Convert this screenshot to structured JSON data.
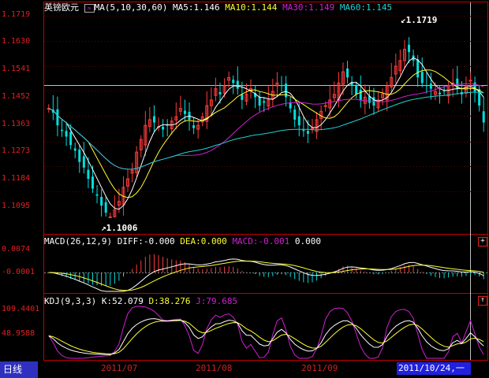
{
  "symbol": "英镑欧元",
  "colors": {
    "frame": "#c00000",
    "up": "#ff3c3c",
    "down": "#00e0e0",
    "ma5": "#ffffff",
    "ma10": "#ffff30",
    "ma30": "#d020d0",
    "ma60": "#20d0d0",
    "macd_pos": "#ff3c3c",
    "macd_neg": "#00e0e0",
    "diff": "#ffffff",
    "dea": "#ffff30",
    "k": "#ffffff",
    "d": "#ffff30",
    "j": "#d020d0",
    "bottom_tab_bg": "#3030c0",
    "date_bg": "#2020e0"
  },
  "price_panel": {
    "legend": {
      "icon": "ma-legend-icon",
      "ma_label": "MA(5,10,30,60)",
      "ma5": "MA5:1.146",
      "ma10": "MA10:1.144",
      "ma30": "MA30:1.149",
      "ma60": "MA60:1.145"
    },
    "y_labels": [
      "1.1719",
      "1.1630",
      "1.1541",
      "1.1452",
      "1.1363",
      "1.1273",
      "1.1184",
      "1.1095"
    ],
    "high_label": "1.1719",
    "low_label": "1.1006"
  },
  "macd_panel": {
    "title": "MACD(26,12,9)",
    "diff": "DIFF:-0.000",
    "dea": "DEA:0.000",
    "macd": "MACD:-0.001",
    "extra": "0.000",
    "y_labels": [
      "0.0074",
      "-0.0001"
    ],
    "expand_icon": "plus-icon"
  },
  "kdj_panel": {
    "title": "KDJ(9,3,3)",
    "k": "K:52.079",
    "d": "D:38.276",
    "j": "J:79.685",
    "y_labels": [
      "109.4401",
      "48.9588"
    ],
    "expand_icon": "up-arrow-icon"
  },
  "x_axis": {
    "ticks": [
      "2011/07",
      "2011/08",
      "2011/09"
    ],
    "current_date": "2011/10/24,一"
  },
  "bottom_tab": "日线",
  "chart_data": [
    {
      "type": "candlestick",
      "title": "英镑欧元",
      "ylim": [
        1.1006,
        1.1719
      ],
      "x_ticks": [
        "2011/07",
        "2011/08",
        "2011/09"
      ],
      "series": [
        {
          "name": "MA5",
          "last": 1.146
        },
        {
          "name": "MA10",
          "last": 1.144
        },
        {
          "name": "MA30",
          "last": 1.149
        },
        {
          "name": "MA60",
          "last": 1.145
        }
      ],
      "annotations": {
        "high": 1.1719,
        "low": 1.1006
      },
      "close": [
        1.139,
        1.1375,
        1.133,
        1.131,
        1.129,
        1.126,
        1.124,
        1.12,
        1.118,
        1.114,
        1.1105,
        1.108,
        1.1045,
        1.102,
        1.1005,
        1.103,
        1.106,
        1.111,
        1.114,
        1.117,
        1.1235,
        1.128,
        1.133,
        1.135,
        1.134,
        1.1325,
        1.1315,
        1.133,
        1.1345,
        1.136,
        1.139,
        1.137,
        1.135,
        1.132,
        1.133,
        1.136,
        1.14,
        1.142,
        1.146,
        1.144,
        1.147,
        1.15,
        1.148,
        1.146,
        1.142,
        1.144,
        1.146,
        1.143,
        1.14,
        1.141,
        1.142,
        1.145,
        1.148,
        1.147,
        1.143,
        1.139,
        1.135,
        1.133,
        1.131,
        1.13,
        1.132,
        1.135,
        1.138,
        1.14,
        1.142,
        1.144,
        1.148,
        1.152,
        1.15,
        1.147,
        1.144,
        1.142,
        1.143,
        1.141,
        1.14,
        1.142,
        1.144,
        1.147,
        1.15,
        1.154,
        1.156,
        1.16,
        1.159,
        1.156,
        1.15,
        1.148,
        1.147,
        1.146,
        1.145,
        1.144,
        1.145,
        1.147,
        1.148,
        1.146,
        1.144,
        1.147,
        1.149,
        1.145,
        1.14,
        1.134
      ]
    },
    {
      "type": "bar",
      "title": "MACD(26,12,9)",
      "series": [
        {
          "name": "DIFF",
          "last": -0.0
        },
        {
          "name": "DEA",
          "last": 0.0
        },
        {
          "name": "MACD",
          "last": -0.001
        }
      ],
      "y_labels": [
        0.0074,
        -0.0001
      ]
    },
    {
      "type": "line",
      "title": "KDJ(9,3,3)",
      "series": [
        {
          "name": "K",
          "last": 52.079
        },
        {
          "name": "D",
          "last": 38.276
        },
        {
          "name": "J",
          "last": 79.685
        }
      ],
      "y_labels": [
        109.4401,
        48.9588
      ]
    }
  ]
}
